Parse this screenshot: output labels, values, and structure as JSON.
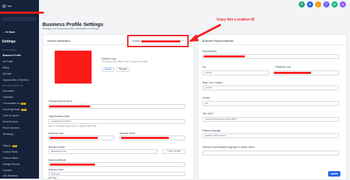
{
  "sidebar": {
    "brand": "MIKI",
    "back": "← Go Back",
    "heading": "Settings",
    "sections": [
      "MY BUSINESS",
      "BUSINESS SERVICES"
    ],
    "items": [
      {
        "label": "Business Profile",
        "active": true
      },
      {
        "label": "My Profile"
      },
      {
        "label": "Billing"
      },
      {
        "label": "My Staff"
      },
      {
        "label": "Opportunities & Pipelines"
      },
      {
        "label": "Automation"
      },
      {
        "label": "Calendars"
      },
      {
        "label": "Conversation AI",
        "badge": "New"
      },
      {
        "label": "Knowledge Base",
        "badge": "New"
      },
      {
        "label": "Voice AI Agents"
      },
      {
        "label": "Email Services"
      },
      {
        "label": "Phone Numbers"
      },
      {
        "label": "WhatsApp"
      },
      {
        "label": "Objects",
        "badge": "New"
      },
      {
        "label": "Custom Fields"
      },
      {
        "label": "Custom Values"
      },
      {
        "label": "Manage Scoring"
      },
      {
        "label": "Domains"
      },
      {
        "label": "URL Redirects"
      }
    ]
  },
  "top_icons": [
    {
      "name": "phone-icon",
      "glyph": "✆",
      "color": "#22a06b"
    },
    {
      "name": "megaphone-icon",
      "glyph": "➤",
      "color": "#2563eb"
    },
    {
      "name": "bell-icon",
      "glyph": "♪",
      "color": "#f59e0b"
    },
    {
      "name": "help-icon",
      "glyph": "?",
      "color": "#6366f1"
    },
    {
      "name": "chat-icon",
      "glyph": "✉",
      "color": "#10b981"
    },
    {
      "name": "avatar-icon",
      "glyph": "●",
      "color": "#8b5cf6"
    }
  ],
  "page": {
    "title": "Business Profile Settings",
    "subtitle": "Manage your business profile information & settings",
    "annotation": "Copy this Location ID"
  },
  "general": {
    "title": "General Information",
    "location_id_label": "Location ID",
    "logo_label": "Business Logo",
    "logo_hint": "The proposed size is 350px * 180px. No bigger than 2.5 MB",
    "upload": "Upload",
    "remove": "Remove",
    "friendly_name_label": "Friendly Business Name",
    "legal_name_label": "Legal Business Name",
    "legal_name_placeholder": "Legal Business Name",
    "legal_hint": "Enter the exact legal business name, as registered with the EIN",
    "email_label": "Business Email",
    "phone_label": "Business Phone",
    "branded_domain_label": "Branded Domain",
    "branded_domain_placeholder": "Branded Domain",
    "add_domain": "+ Add Domain",
    "website_label": "Business Website",
    "niche_label": "Business Niche",
    "niche_value": "Recruiter",
    "api_key_label": "API Key"
  },
  "address": {
    "title": "Business Physical Address",
    "street_label": "Street Address",
    "city_label": "City",
    "city_value": "London",
    "postal_label": "Postal/Zip Code",
    "state_label": "State / Prov / Region",
    "state_value": "London",
    "country_label": "Country",
    "country_value": "UK",
    "tz_label": "Time Zone *",
    "tz_value": "GMT+01:00 Europe/London (BST)",
    "platform_lang_label": "Platform Language",
    "platform_lang_value": "English (United States)",
    "outbound_lang_label": "Outbound communication language for custom values"
  },
  "actions": {
    "update": "Update"
  }
}
